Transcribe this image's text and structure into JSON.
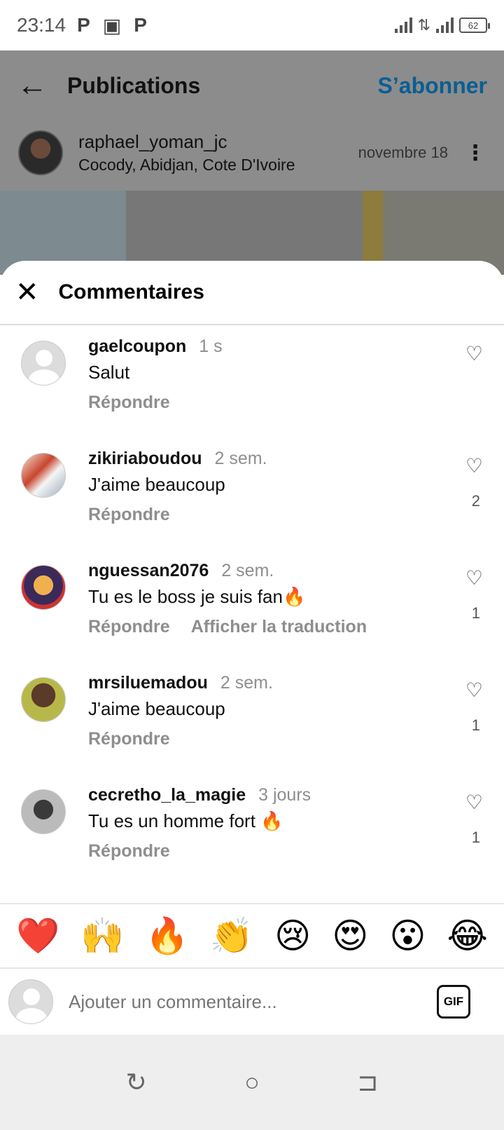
{
  "status_bar": {
    "time": "23:14",
    "notif_icons": [
      "p-icon",
      "app-icon",
      "p-icon"
    ],
    "battery": "62"
  },
  "header": {
    "title": "Publications",
    "follow_label": "S’abonner"
  },
  "post": {
    "username": "raphael_yoman_jc",
    "location": "Cocody, Abidjan, Cote D'Ivoire",
    "date": "novembre 18"
  },
  "sheet": {
    "title": "Commentaires"
  },
  "comments": [
    {
      "user": "gaelcoupon",
      "time": "1 s",
      "text": "Salut",
      "reply": "Répondre",
      "translate": "",
      "likes": ""
    },
    {
      "user": "zikiriaboudou",
      "time": "2 sem.",
      "text": "J'aime beaucoup",
      "reply": "Répondre",
      "translate": "",
      "likes": "2"
    },
    {
      "user": "nguessan2076",
      "time": "2 sem.",
      "text": "Tu es le boss je suis fan🔥",
      "reply": "Répondre",
      "translate": "Afficher la traduction",
      "likes": "1"
    },
    {
      "user": "mrsiluemadou",
      "time": "2 sem.",
      "text": "J'aime beaucoup",
      "reply": "Répondre",
      "translate": "",
      "likes": "1"
    },
    {
      "user": "cecretho_la_magie",
      "time": "3 jours",
      "text": "Tu es un homme fort 🔥",
      "reply": "Répondre",
      "translate": "",
      "likes": "1"
    }
  ],
  "emojis": [
    "❤️",
    "🙌",
    "🔥",
    "👏",
    "😢",
    "😍",
    "😮",
    "😂"
  ],
  "composer": {
    "placeholder": "Ajouter un commentaire...",
    "gif_label": "GIF"
  },
  "colors": {
    "follow": "#0b5e93",
    "muted": "#8e8e8e"
  }
}
